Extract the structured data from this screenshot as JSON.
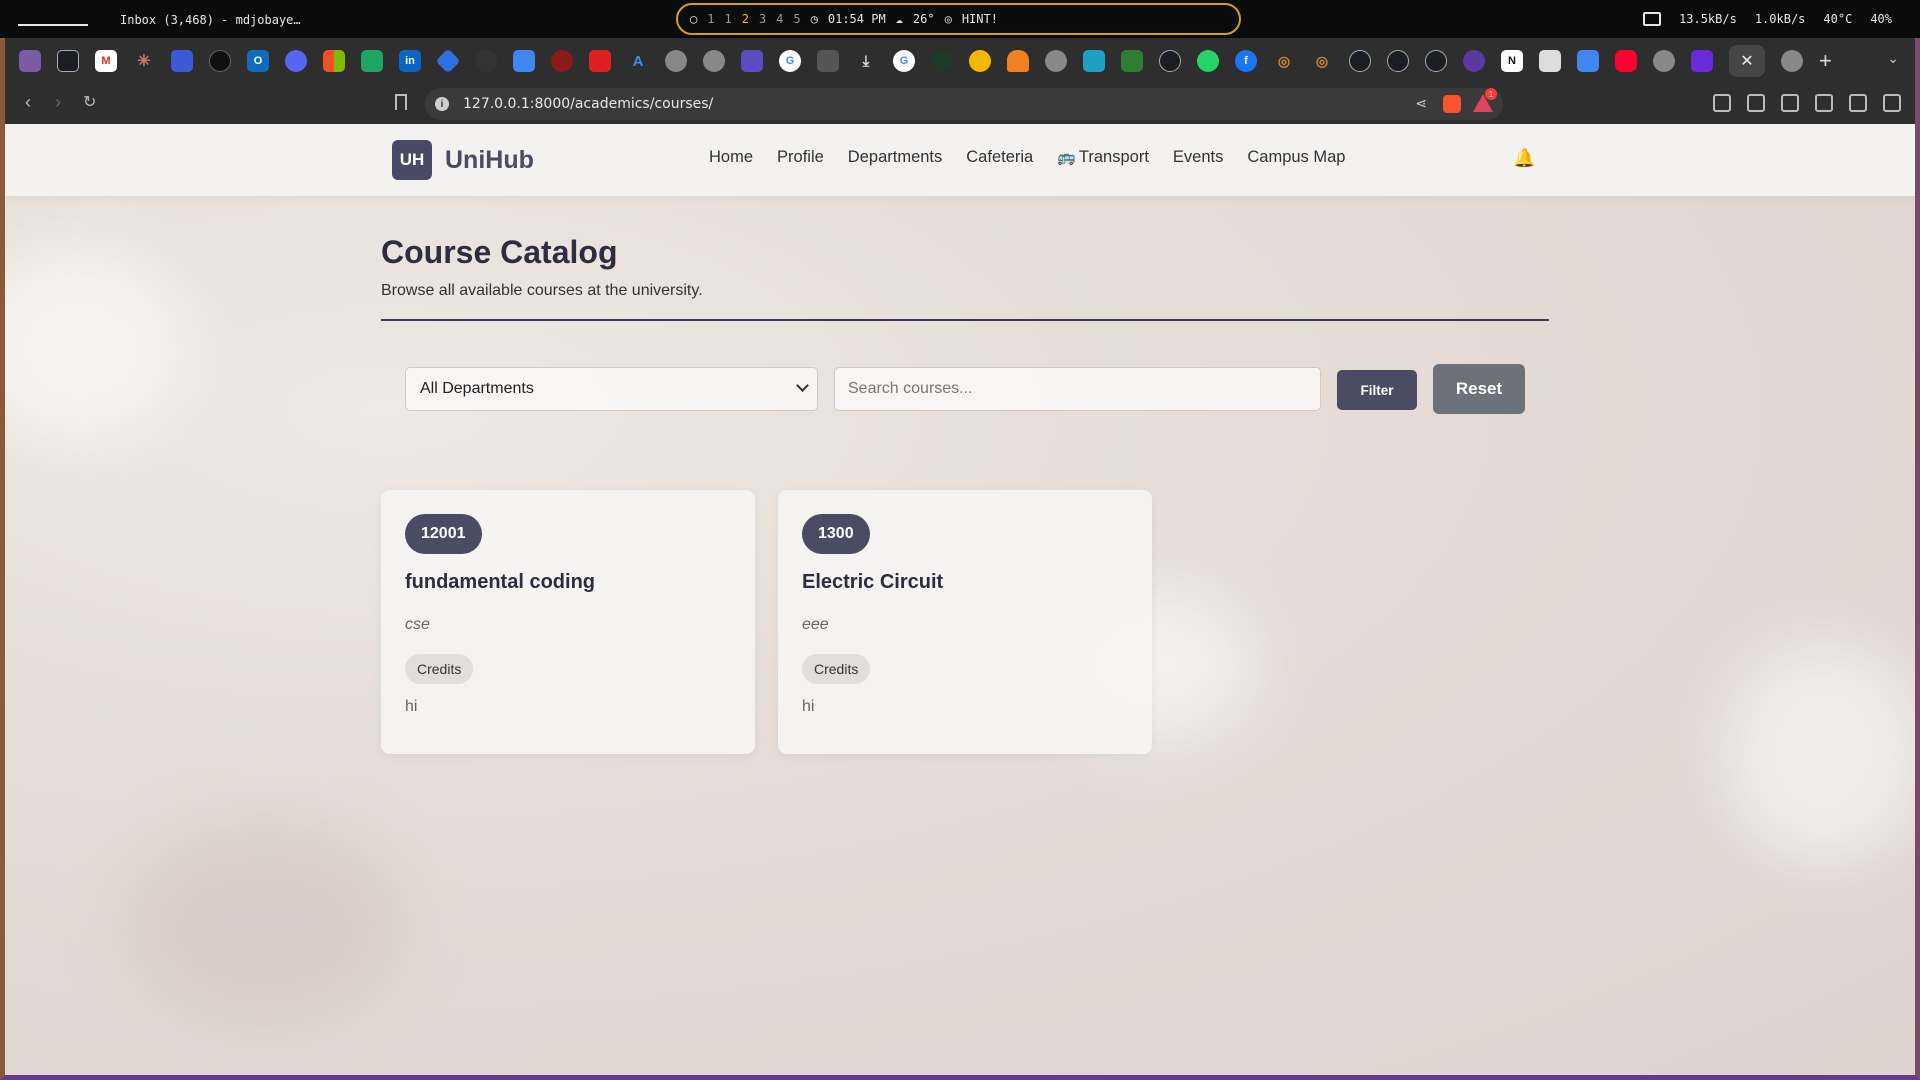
{
  "system_bar": {
    "window_title": "Inbox (3,468) - mdjobaye…",
    "workspaces": [
      "1",
      "1",
      "2",
      "3",
      "4",
      "5"
    ],
    "active_workspace": "2",
    "clock": "01:54 PM",
    "weather": "26°",
    "hint": "HINT!",
    "net_down": "13.5kB/s",
    "net_up": "1.0kB/s",
    "temperature": "40°C",
    "volume": "40%"
  },
  "browser": {
    "url": "127.0.0.1:8000/academics/courses/",
    "rewards_badge": "1",
    "tab_icons": [
      "tor",
      "github",
      "gmail",
      "claude",
      "ext",
      "circle",
      "outlook",
      "discord",
      "windows",
      "sheets",
      "linkedin",
      "diamond",
      "blank",
      "docs",
      "pinterest",
      "ext-red",
      "azure",
      "globe",
      "globe",
      "notes",
      "google",
      "dark",
      "download",
      "google",
      "ext",
      "bell",
      "cloud",
      "globe",
      "ext",
      "mail",
      "github",
      "whatsapp",
      "facebook",
      "ext",
      "ext",
      "github",
      "github",
      "github",
      "ext",
      "notion",
      "ext",
      "docs",
      "youtube",
      "globe",
      "vscode"
    ]
  },
  "site": {
    "logo_text": "UH",
    "brand": "UniHub",
    "nav": [
      "Home",
      "Profile",
      "Departments",
      "Cafeteria",
      "Transport",
      "Events",
      "Campus Map"
    ]
  },
  "page": {
    "title": "Course Catalog",
    "subtitle": "Browse all available courses at the university."
  },
  "filters": {
    "department_selected": "All Departments",
    "search_placeholder": "Search courses...",
    "filter_label": "Filter",
    "reset_label": "Reset"
  },
  "courses": [
    {
      "code": "12001",
      "name": "fundamental coding",
      "department": "cse",
      "credits_label": "Credits",
      "description": "hi"
    },
    {
      "code": "1300",
      "name": "Electric Circuit",
      "department": "eee",
      "credits_label": "Credits",
      "description": "hi"
    }
  ],
  "colors": {
    "brand": "#4b4b63",
    "reset": "#6c727a",
    "page_bg": "#e5dcd7"
  }
}
